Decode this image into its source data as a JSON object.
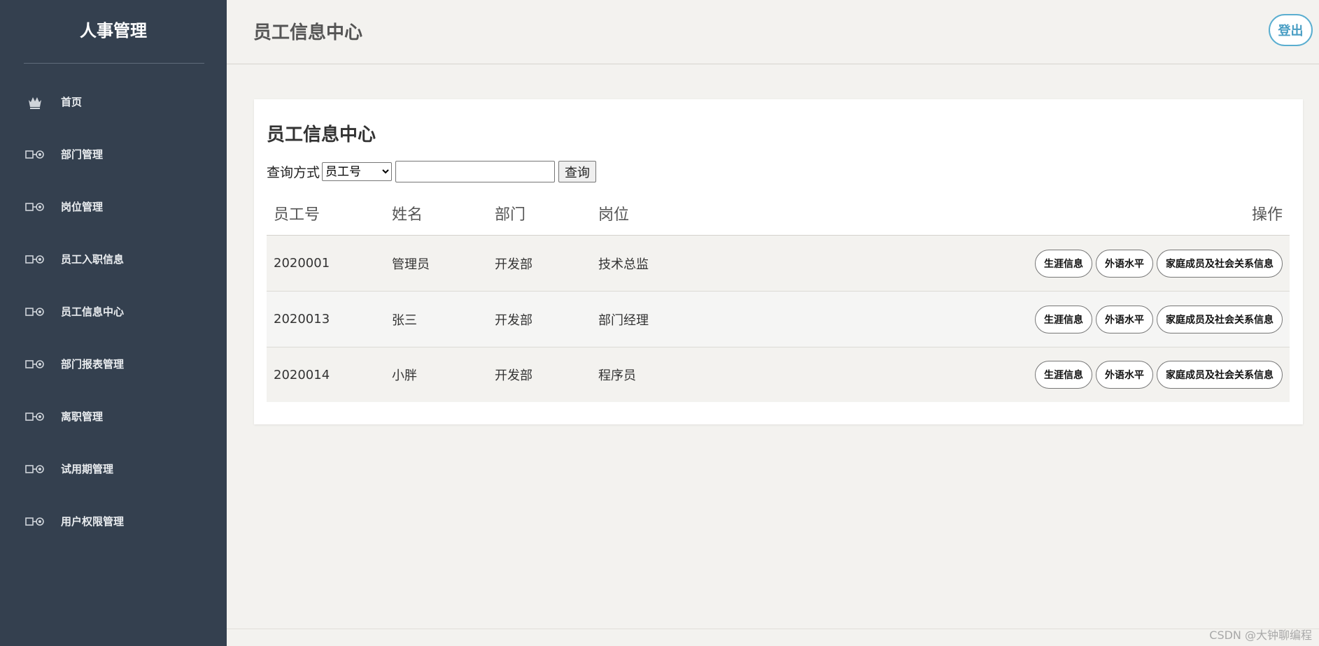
{
  "sidebar": {
    "title": "人事管理",
    "items": [
      {
        "label": "首页",
        "icon": "home-icon"
      },
      {
        "label": "部门管理",
        "icon": "arrow-circle-icon"
      },
      {
        "label": "岗位管理",
        "icon": "arrow-circle-icon"
      },
      {
        "label": "员工入职信息",
        "icon": "arrow-circle-icon"
      },
      {
        "label": "员工信息中心",
        "icon": "arrow-circle-icon"
      },
      {
        "label": "部门报表管理",
        "icon": "arrow-circle-icon"
      },
      {
        "label": "离职管理",
        "icon": "arrow-circle-icon"
      },
      {
        "label": "试用期管理",
        "icon": "arrow-circle-icon"
      },
      {
        "label": "用户权限管理",
        "icon": "arrow-circle-icon"
      }
    ]
  },
  "header": {
    "title": "员工信息中心",
    "logout_label": "登出"
  },
  "main": {
    "card_title": "员工信息中心",
    "query": {
      "label": "查询方式",
      "selected_option": "员工号",
      "input_value": "",
      "button_label": "查询"
    },
    "table": {
      "headers": {
        "id": "员工号",
        "name": "姓名",
        "dept": "部门",
        "position": "岗位",
        "ops": "操作"
      },
      "rows": [
        {
          "id": "2020001",
          "name": "管理员",
          "dept": "开发部",
          "position": "技术总监"
        },
        {
          "id": "2020013",
          "name": "张三",
          "dept": "开发部",
          "position": "部门经理"
        },
        {
          "id": "2020014",
          "name": "小胖",
          "dept": "开发部",
          "position": "程序员"
        }
      ],
      "row_actions": [
        "生涯信息",
        "外语水平",
        "家庭成员及社会关系信息"
      ]
    }
  },
  "watermark": "CSDN @大钟聊编程",
  "colors": {
    "sidebar_bg": "#34404f",
    "page_bg": "#f3f2ef",
    "logout_accent": "#5aaed0"
  }
}
